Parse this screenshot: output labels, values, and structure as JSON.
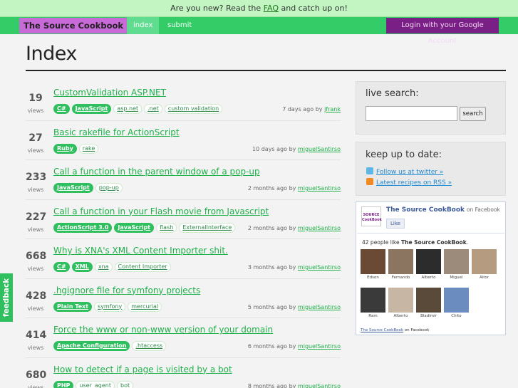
{
  "banner": {
    "text_before": "Are you new? Read the ",
    "link": "FAQ",
    "text_after": " and catch up on!"
  },
  "nav": {
    "brand": "The Source Cookbook",
    "tabs": [
      "index",
      "submit"
    ],
    "login": "Login with your Google Account"
  },
  "page": {
    "title": "Index"
  },
  "rows": [
    {
      "count": "19",
      "views": "views",
      "title": "CustomValidation ASP.NET",
      "tags": [
        {
          "t": "C#",
          "hl": true
        },
        {
          "t": "JavaScript",
          "hl": true
        },
        {
          "t": "asp.net"
        },
        {
          "t": ".net"
        },
        {
          "t": "custom validation"
        }
      ],
      "time": "7 days ago",
      "by": "by",
      "user": "jfrank"
    },
    {
      "count": "27",
      "views": "views",
      "title": "Basic rakefile for ActionScript",
      "tags": [
        {
          "t": "Ruby",
          "hl": true
        },
        {
          "t": "rake"
        }
      ],
      "time": "10 days ago",
      "by": "by",
      "user": "miguelSantirso"
    },
    {
      "count": "233",
      "views": "views",
      "title": "Call a function in the parent window of a pop-up",
      "tags": [
        {
          "t": "JavaScript",
          "hl": true
        },
        {
          "t": "pop-up"
        }
      ],
      "time": "2 months ago",
      "by": "by",
      "user": "miguelSantirso"
    },
    {
      "count": "227",
      "views": "views",
      "title": "Call a function in your Flash movie from Javascript",
      "tags": [
        {
          "t": "ActionScript 3.0",
          "hl": true
        },
        {
          "t": "JavaScript",
          "hl": true
        },
        {
          "t": "flash"
        },
        {
          "t": "ExternalInterface"
        }
      ],
      "time": "2 months ago",
      "by": "by",
      "user": "miguelSantirso"
    },
    {
      "count": "668",
      "views": "views",
      "title": "Why is XNA's XML Content Importer shit.",
      "tags": [
        {
          "t": "C#",
          "hl": true
        },
        {
          "t": "XML",
          "hl": true
        },
        {
          "t": "xna"
        },
        {
          "t": "Content Importer"
        }
      ],
      "time": "3 months ago",
      "by": "by",
      "user": "miguelSantirso"
    },
    {
      "count": "428",
      "views": "views",
      "title": ".hgignore file for symfony projects",
      "tags": [
        {
          "t": "Plain Text",
          "hl": true
        },
        {
          "t": "symfony"
        },
        {
          "t": "mercurial"
        }
      ],
      "time": "5 months ago",
      "by": "by",
      "user": "miguelSantirso"
    },
    {
      "count": "414",
      "views": "views",
      "title": "Force the www or non-www version of your domain",
      "tags": [
        {
          "t": "Apache Configuration",
          "hl": true
        },
        {
          "t": ".htaccess"
        }
      ],
      "time": "6 months ago",
      "by": "by",
      "user": "miguelSantirso"
    },
    {
      "count": "680",
      "views": "views",
      "title": "How to detect if a page is visited by a bot",
      "tags": [
        {
          "t": "PHP",
          "hl": true
        },
        {
          "t": "user_agent"
        },
        {
          "t": "bot"
        }
      ],
      "time": "8 months ago",
      "by": "by",
      "user": "miguelSantirso"
    }
  ],
  "sidebar": {
    "search_heading": "live search:",
    "search_button": "search",
    "search_value": "",
    "keep_heading": "keep up to date:",
    "twitter": "Follow us at twitter »",
    "rss": "Latest recipes on RSS »"
  },
  "facebook": {
    "logo_text": "SOURCE CookBook",
    "page_name": "The Source CookBook",
    "on": "on Facebook",
    "like": "Like",
    "count_prefix": "42 people like ",
    "count_page": "The Source CookBook",
    "count_suffix": ".",
    "faces": [
      "Edson",
      "Fernando",
      "Alberto",
      "Miguel",
      "Aitor",
      "Ram",
      "Alberto",
      "Bladimir",
      "Chito"
    ],
    "footer_link": "The Source CookBook",
    "footer_text": " on Facebook"
  },
  "feedback": "feedback"
}
